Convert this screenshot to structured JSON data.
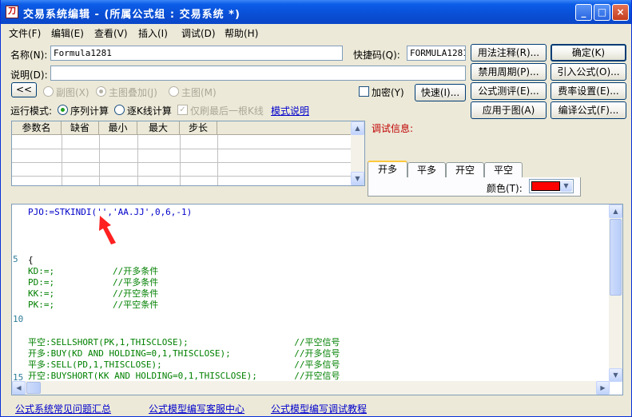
{
  "window": {
    "title": "交易系统编辑 - (所属公式组 : 交易系统 *)",
    "icon_text": "刀",
    "controls": {
      "minimize": "_",
      "maximize": "□",
      "close": "×"
    }
  },
  "menu": [
    "文件(F)",
    "编辑(E)",
    "查看(V)",
    "插入(I)",
    "调试(D)",
    "帮助(H)"
  ],
  "form": {
    "name_label": "名称(N):",
    "name_value": "Formula1281",
    "shortcut_label": "快捷码(Q):",
    "shortcut_value": "FORMULA1281",
    "desc_label": "说明(D):",
    "desc_value": "",
    "collapse_button": "<<",
    "mode_options": [
      "副图(X)",
      "主图叠加(J)",
      "主图(M)"
    ],
    "encrypt_label": "加密(Y)",
    "quick_button": "快速(I)...",
    "run_mode_label": "运行模式:",
    "run_options": [
      "序列计算",
      "逐K线计算"
    ],
    "last_bar_label": "仅刷最后一根K线",
    "mode_link": "模式说明"
  },
  "buttons": {
    "syntax_help": "用法注释(R)...",
    "disabled_period": "禁用周期(P)...",
    "evaluate": "公式测评(E)...",
    "apply_chart": "应用于图(A)",
    "ok": "确定(K)",
    "import": "引入公式(O)...",
    "fee": "费率设置(E)...",
    "compile": "编译公式(F)..."
  },
  "param_table": {
    "headers": [
      "参数名",
      "缺省",
      "最小",
      "最大",
      "步长"
    ]
  },
  "debug": {
    "label": "调试信息:",
    "tabs": [
      "开多",
      "平多",
      "开空",
      "平空"
    ],
    "color_label": "颜色(T):",
    "color_value": "#ff0000"
  },
  "editor": {
    "line_numbers": [
      "5",
      "10",
      "15"
    ],
    "lines": [
      "PJO:=STKINDI('','AA.JJ',0,6,-1)",
      "{",
      "KD:=;           //开多条件",
      "PD:=;           //平多条件",
      "KK:=;           //开空条件",
      "PK:=;           //平空条件",
      "平空:SELLSHORT(PK,1,THISCLOSE);                    //平空信号",
      "开多:BUY(KD AND HOLDING=0,1,THISCLOSE);            //开多信号",
      "平多:SELL(PD,1,THISCLOSE);                         //平多信号",
      "开空:BUYSHORT(KK AND HOLDING=0,1,THISCLOSE);       //开空信号"
    ]
  },
  "footer_links": [
    "公式系统常见问题汇总",
    "公式模型编写客服中心",
    "公式模型编写调试教程"
  ],
  "colors": {
    "titlebar": "#0a4fd6",
    "link": "#0000cc",
    "comment": "#008000",
    "keyword": "#0000cc",
    "arrow": "#ff0000"
  },
  "icons": [
    "minimize-icon",
    "maximize-icon",
    "close-icon",
    "chevron-up-icon",
    "chevron-down-icon",
    "chevron-left-icon",
    "chevron-right-icon",
    "red-arrow-annotation"
  ]
}
